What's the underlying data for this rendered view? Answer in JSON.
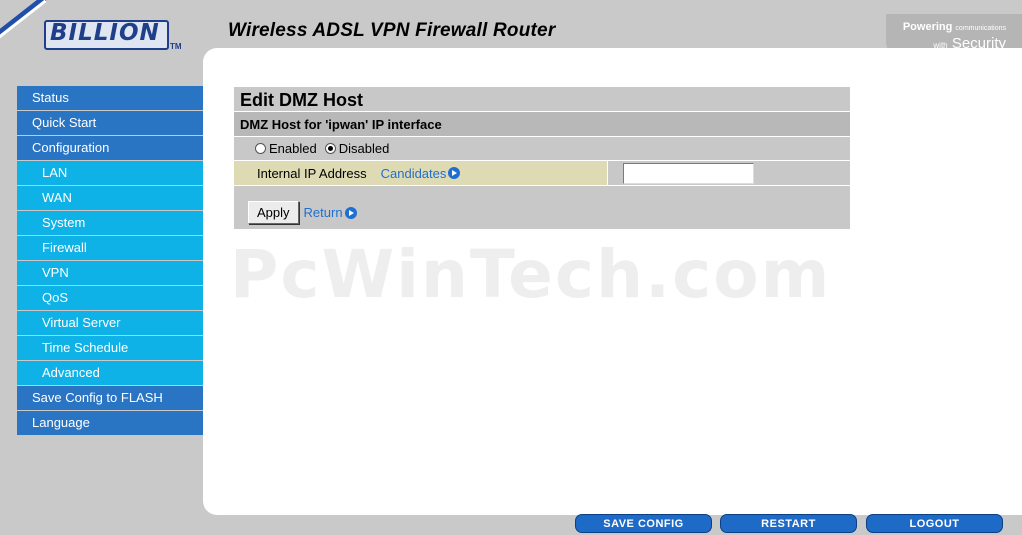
{
  "header": {
    "logo_text": "BILLION",
    "logo_tm": "TM",
    "title": "Wireless ADSL VPN Firewall Router",
    "tagline_top": "Powering",
    "tagline_top_small": "communications",
    "tagline_bottom_small": "with",
    "tagline_bottom": "Security"
  },
  "sidebar": {
    "items": [
      {
        "label": "Status",
        "level": "main"
      },
      {
        "label": "Quick Start",
        "level": "main"
      },
      {
        "label": "Configuration",
        "level": "main"
      },
      {
        "label": "LAN",
        "level": "sub"
      },
      {
        "label": "WAN",
        "level": "sub"
      },
      {
        "label": "System",
        "level": "sub"
      },
      {
        "label": "Firewall",
        "level": "sub"
      },
      {
        "label": "VPN",
        "level": "sub"
      },
      {
        "label": "QoS",
        "level": "sub"
      },
      {
        "label": "Virtual Server",
        "level": "sub"
      },
      {
        "label": "Time Schedule",
        "level": "sub"
      },
      {
        "label": "Advanced",
        "level": "sub"
      },
      {
        "label": "Save Config to FLASH",
        "level": "main"
      },
      {
        "label": "Language",
        "level": "main"
      }
    ]
  },
  "form": {
    "title": "Edit DMZ Host",
    "subtitle": "DMZ Host for 'ipwan' IP interface",
    "radio_enabled": "Enabled",
    "radio_disabled": "Disabled",
    "selected": "Disabled",
    "ip_label": "Internal IP Address",
    "candidates_link": "Candidates",
    "ip_value": "",
    "apply_label": "Apply",
    "return_link": "Return"
  },
  "watermark": "PcWinTech.com",
  "footer": {
    "save_config": "SAVE CONFIG",
    "restart": "RESTART",
    "logout": "LOGOUT"
  },
  "colors": {
    "nav_main": "#2a74c4",
    "nav_sub": "#0fb2e6",
    "footer_button": "#1d6ac7",
    "link": "#1f6fd0"
  },
  "icons": [
    "arrow-circle-icon"
  ]
}
